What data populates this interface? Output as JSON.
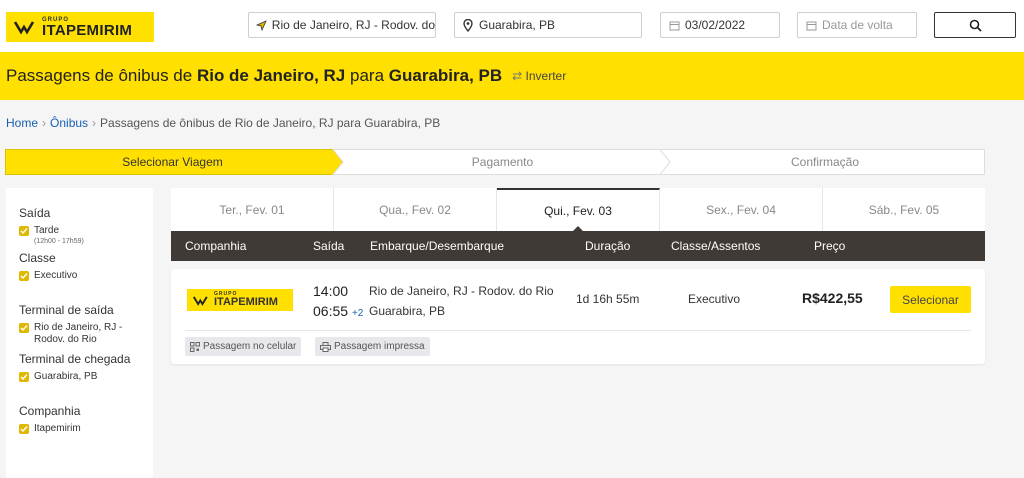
{
  "brand": {
    "grupo": "GRUPO",
    "name": "ITAPEMIRIM",
    "yellow": "#ffe000",
    "dark": "#403a36"
  },
  "search": {
    "origin": "Rio de Janeiro, RJ - Rodov. do",
    "destination": "Guarabira, PB",
    "depart_date": "03/02/2022",
    "return_placeholder": "Data de volta"
  },
  "banner": {
    "prefix": "Passagens de ônibus de",
    "origin": "Rio de Janeiro, RJ",
    "mid": "para",
    "destination": "Guarabira, PB",
    "invert": "Inverter"
  },
  "breadcrumb": {
    "home": "Home",
    "onibus": "Ônibus",
    "current": "Passagens de ônibus de Rio de Janeiro, RJ para Guarabira, PB"
  },
  "steps": [
    "Selecionar Viagem",
    "Pagamento",
    "Confirmação"
  ],
  "filters": {
    "saida": {
      "title": "Saída",
      "item": "Tarde",
      "sub": "(12h00 - 17h59)"
    },
    "classe": {
      "title": "Classe",
      "item": "Executivo"
    },
    "terminal_saida": {
      "title": "Terminal de saída",
      "item_line1": "Rio de Janeiro, RJ -",
      "item_line2": "Rodov. do Rio"
    },
    "terminal_chegada": {
      "title": "Terminal de chegada",
      "item": "Guarabira, PB"
    },
    "companhia": {
      "title": "Companhia",
      "item": "Itapemirim"
    }
  },
  "dates": [
    "Ter., Fev. 01",
    "Qua., Fev. 02",
    "Qui., Fev. 03",
    "Sex., Fev. 04",
    "Sáb., Fev. 05"
  ],
  "columns": {
    "companhia": "Companhia",
    "saida": "Saída",
    "embarque": "Embarque/Desembarque",
    "duracao": "Duração",
    "classe": "Classe/Assentos",
    "preco": "Preço"
  },
  "result": {
    "depart_time": "14:00",
    "arrive_time": "06:55",
    "days_plus": "+2",
    "origin": "Rio de Janeiro, RJ - Rodov. do Rio",
    "destination": "Guarabira, PB",
    "duration": "1d 16h 55m",
    "class": "Executivo",
    "price": "R$422,55",
    "select_label": "Selecionar",
    "tags": [
      "Passagem no celular",
      "Passagem impressa"
    ]
  }
}
